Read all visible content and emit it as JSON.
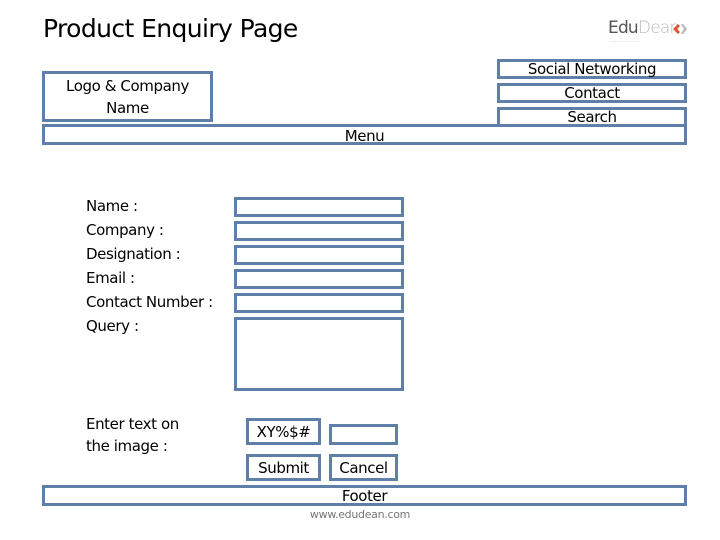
{
  "page": {
    "title": "Product Enquiry Page"
  },
  "brand": {
    "name_part1": "Edu",
    "name_part2": "Dean",
    "icon": "edudean-logo-icon",
    "accent_colors": [
      "#d9562c",
      "#9a9a9a"
    ]
  },
  "header": {
    "logo_box_label": "Logo & Company Name",
    "logo_box_line1": "Logo & Company",
    "logo_box_line2": "Name",
    "right_links": [
      {
        "label": "Social Networking"
      },
      {
        "label": "Contact"
      },
      {
        "label": "Search"
      }
    ],
    "menu_label": "Menu"
  },
  "form": {
    "fields": [
      {
        "label": "Name :",
        "value": ""
      },
      {
        "label": "Company :",
        "value": ""
      },
      {
        "label": "Designation :",
        "value": ""
      },
      {
        "label": "Email :",
        "value": ""
      },
      {
        "label": "Contact Number :",
        "value": ""
      },
      {
        "label": "Query :",
        "value": ""
      }
    ],
    "captcha": {
      "label_line1": "Enter text on",
      "label_line2": "the image :",
      "image_text": "XY%$#",
      "value": ""
    },
    "submit_label": "Submit",
    "cancel_label": "Cancel"
  },
  "footer": {
    "label": "Footer",
    "site_url": "www.edudean.com"
  },
  "colors": {
    "border": "#5e80a8"
  }
}
